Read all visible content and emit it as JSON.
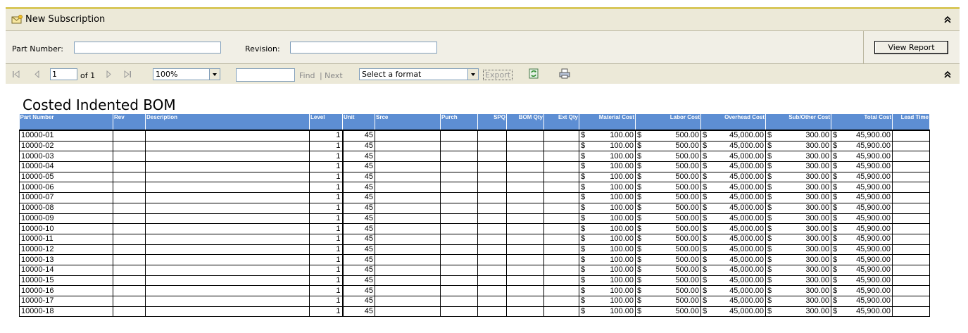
{
  "header": {
    "title": "New Subscription"
  },
  "params": {
    "part_number_label": "Part Number:",
    "part_number_value": "",
    "revision_label": "Revision:",
    "revision_value": "",
    "view_report_label": "View Report"
  },
  "toolbar": {
    "page_value": "1",
    "page_of": "of 1",
    "zoom": "100%",
    "find_value": "",
    "find_label": "Find",
    "separator": "|",
    "next_label": "Next",
    "format_select": "Select a format",
    "export_label": "Export"
  },
  "report": {
    "title": "Costed Indented BOM",
    "columns": [
      {
        "label": "Part Number",
        "align": "l"
      },
      {
        "label": "Rev",
        "align": "l"
      },
      {
        "label": "Description",
        "align": "l"
      },
      {
        "label": "Level",
        "align": "l"
      },
      {
        "label": "Unit",
        "align": "l"
      },
      {
        "label": "Srce",
        "align": "l"
      },
      {
        "label": "Purch",
        "align": "l"
      },
      {
        "label": "SPQ",
        "align": "r"
      },
      {
        "label": "BOM Qty",
        "align": "r"
      },
      {
        "label": "Ext Qty",
        "align": "r"
      },
      {
        "label": "Material Cost",
        "align": "r"
      },
      {
        "label": "Labor Cost",
        "align": "r"
      },
      {
        "label": "Overhead Cost",
        "align": "r"
      },
      {
        "label": "Sub/Other Cost",
        "align": "r"
      },
      {
        "label": "Total Cost",
        "align": "r"
      },
      {
        "label": "Lead Time",
        "align": "r"
      }
    ],
    "rows": [
      {
        "part": "10000-01",
        "level": "1",
        "unit": "45",
        "material": "100.00",
        "labor": "500.00",
        "overhead": "45,000.00",
        "sub": "300.00",
        "total": "45,900.00"
      },
      {
        "part": "10000-02",
        "level": "1",
        "unit": "45",
        "material": "100.00",
        "labor": "500.00",
        "overhead": "45,000.00",
        "sub": "300.00",
        "total": "45,900.00"
      },
      {
        "part": "10000-03",
        "level": "1",
        "unit": "45",
        "material": "100.00",
        "labor": "500.00",
        "overhead": "45,000.00",
        "sub": "300.00",
        "total": "45,900.00"
      },
      {
        "part": "10000-04",
        "level": "1",
        "unit": "45",
        "material": "100.00",
        "labor": "500.00",
        "overhead": "45,000.00",
        "sub": "300.00",
        "total": "45,900.00"
      },
      {
        "part": "10000-05",
        "level": "1",
        "unit": "45",
        "material": "100.00",
        "labor": "500.00",
        "overhead": "45,000.00",
        "sub": "300.00",
        "total": "45,900.00"
      },
      {
        "part": "10000-06",
        "level": "1",
        "unit": "45",
        "material": "100.00",
        "labor": "500.00",
        "overhead": "45,000.00",
        "sub": "300.00",
        "total": "45,900.00"
      },
      {
        "part": "10000-07",
        "level": "1",
        "unit": "45",
        "material": "100.00",
        "labor": "500.00",
        "overhead": "45,000.00",
        "sub": "300.00",
        "total": "45,900.00"
      },
      {
        "part": "10000-08",
        "level": "1",
        "unit": "45",
        "material": "100.00",
        "labor": "500.00",
        "overhead": "45,000.00",
        "sub": "300.00",
        "total": "45,900.00"
      },
      {
        "part": "10000-09",
        "level": "1",
        "unit": "45",
        "material": "100.00",
        "labor": "500.00",
        "overhead": "45,000.00",
        "sub": "300.00",
        "total": "45,900.00"
      },
      {
        "part": "10000-10",
        "level": "1",
        "unit": "45",
        "material": "100.00",
        "labor": "500.00",
        "overhead": "45,000.00",
        "sub": "300.00",
        "total": "45,900.00"
      },
      {
        "part": "10000-11",
        "level": "1",
        "unit": "45",
        "material": "100.00",
        "labor": "500.00",
        "overhead": "45,000.00",
        "sub": "300.00",
        "total": "45,900.00"
      },
      {
        "part": "10000-12",
        "level": "1",
        "unit": "45",
        "material": "100.00",
        "labor": "500.00",
        "overhead": "45,000.00",
        "sub": "300.00",
        "total": "45,900.00"
      },
      {
        "part": "10000-13",
        "level": "1",
        "unit": "45",
        "material": "100.00",
        "labor": "500.00",
        "overhead": "45,000.00",
        "sub": "300.00",
        "total": "45,900.00"
      },
      {
        "part": "10000-14",
        "level": "1",
        "unit": "45",
        "material": "100.00",
        "labor": "500.00",
        "overhead": "45,000.00",
        "sub": "300.00",
        "total": "45,900.00"
      },
      {
        "part": "10000-15",
        "level": "1",
        "unit": "45",
        "material": "100.00",
        "labor": "500.00",
        "overhead": "45,000.00",
        "sub": "300.00",
        "total": "45,900.00"
      },
      {
        "part": "10000-16",
        "level": "1",
        "unit": "45",
        "material": "100.00",
        "labor": "500.00",
        "overhead": "45,000.00",
        "sub": "300.00",
        "total": "45,900.00"
      },
      {
        "part": "10000-17",
        "level": "1",
        "unit": "45",
        "material": "100.00",
        "labor": "500.00",
        "overhead": "45,000.00",
        "sub": "300.00",
        "total": "45,900.00"
      },
      {
        "part": "10000-18",
        "level": "1",
        "unit": "45",
        "material": "100.00",
        "labor": "500.00",
        "overhead": "45,000.00",
        "sub": "300.00",
        "total": "45,900.00"
      }
    ],
    "currency_symbol": "$"
  },
  "colors": {
    "header_bg": "#5d8ed3",
    "toolbar_bg": "#ece9d8",
    "accent_line": "#d8c75a"
  }
}
